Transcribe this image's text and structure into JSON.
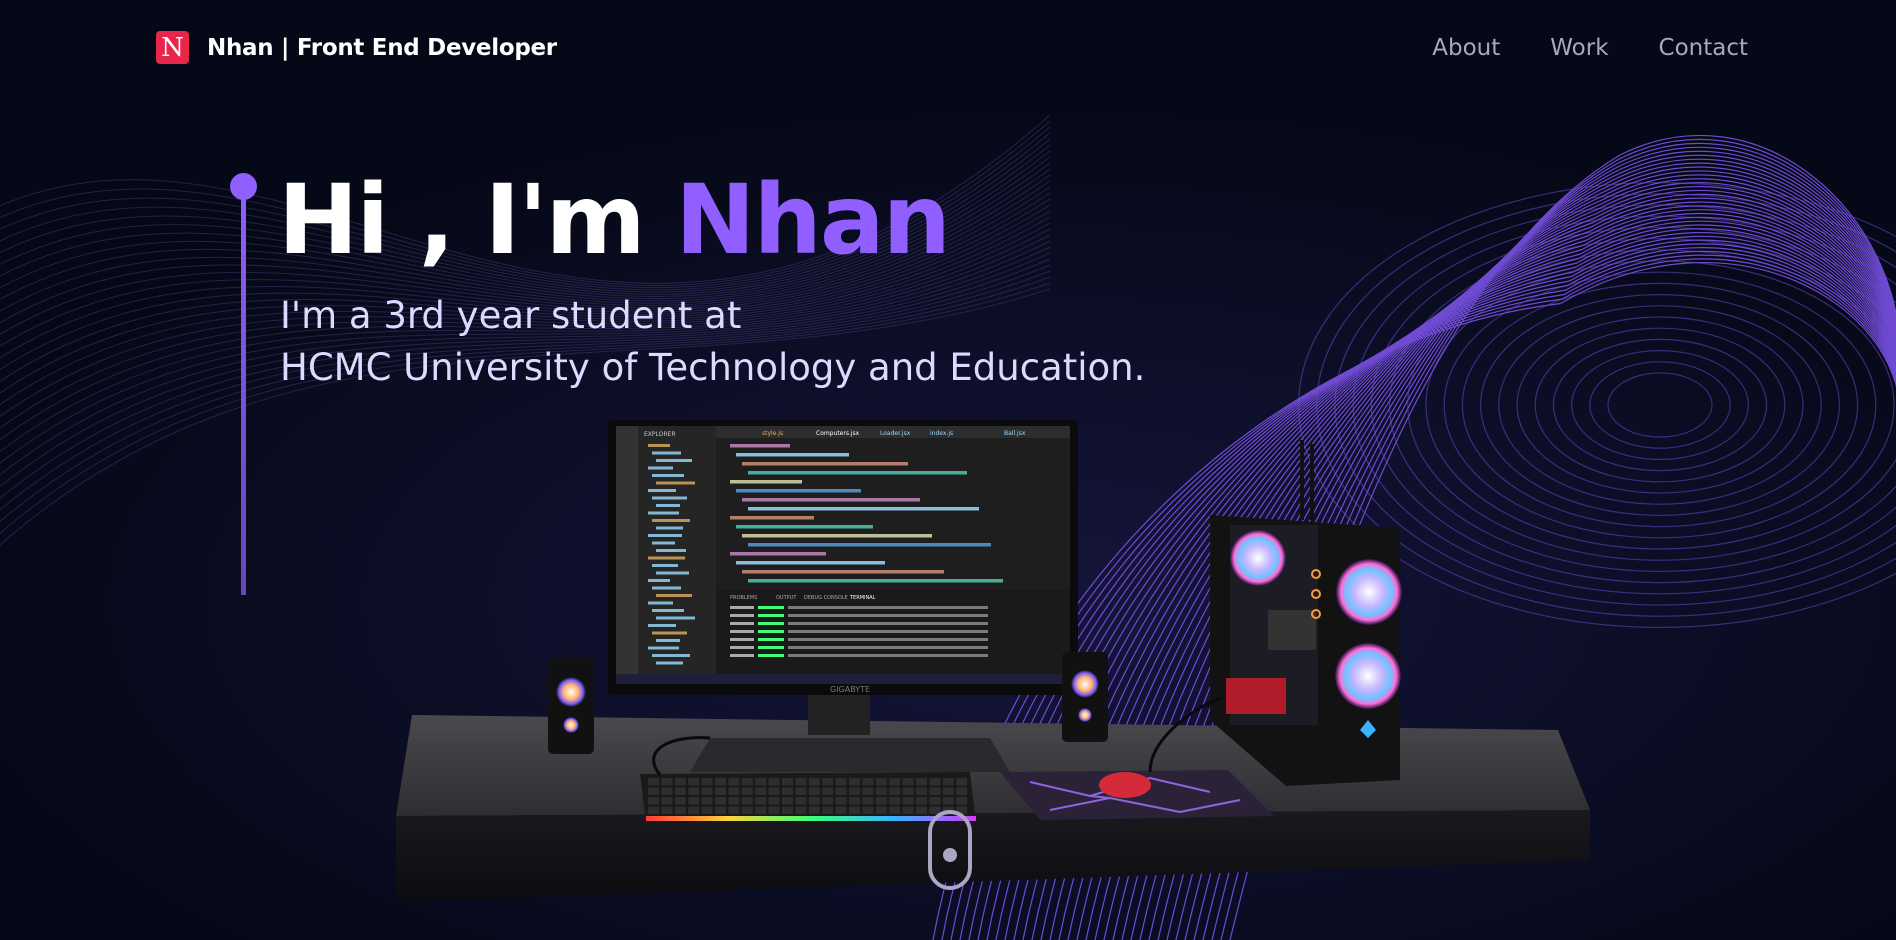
{
  "navbar": {
    "logo_letter": "N",
    "brand": "Nhan | Front End Developer",
    "links": [
      {
        "label": "About"
      },
      {
        "label": "Work"
      },
      {
        "label": "Contact"
      }
    ]
  },
  "hero": {
    "title_prefix": "Hi , I'm ",
    "title_name": "Nhan",
    "subtitle_line1": "I'm a 3rd year student at",
    "subtitle_line2": "HCMC University of Technology and Education."
  },
  "scene": {
    "monitor_brand": "GIGABYTE",
    "editor_tabs": [
      "style.js",
      "Computers.jsx",
      "Loader.jsx",
      "index.js",
      "Ball.jsx"
    ],
    "explorer_title": "EXPLORER",
    "panel_tabs": [
      "PROBLEMS",
      "OUTPUT",
      "DEBUG CONSOLE",
      "TERMINAL"
    ]
  },
  "colors": {
    "accent": "#915eff",
    "background": "#050816",
    "nav_text": "#aaa6c3",
    "logo": "#e8254a"
  },
  "icons": {
    "logo": "logo-icon",
    "scroll": "scroll-mouse-icon"
  }
}
